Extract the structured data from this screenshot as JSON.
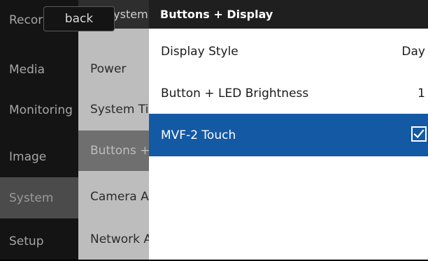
{
  "left_menu": {
    "items": [
      {
        "label": "Record"
      },
      {
        "label": "Media"
      },
      {
        "label": "Monitoring"
      },
      {
        "label": "Image"
      },
      {
        "label": "System",
        "selected": true
      },
      {
        "label": "Setup"
      }
    ]
  },
  "mid_menu": {
    "header": "System",
    "items": [
      {
        "label": "Power"
      },
      {
        "label": "System Time"
      },
      {
        "label": "Buttons + Display",
        "selected": true
      },
      {
        "label": "Camera Access"
      },
      {
        "label": "Network Access"
      }
    ]
  },
  "back_button": {
    "label": "back"
  },
  "settings_panel": {
    "title": "Buttons + Display",
    "rows": [
      {
        "label": "Display Style",
        "value": "Day"
      },
      {
        "label": "Button + LED Brightness",
        "value": "1"
      },
      {
        "label": "MVF-2 Touch",
        "checked": true,
        "selected": true
      }
    ]
  },
  "colors": {
    "selection_blue": "#1459a4",
    "panel_dark": "#141414",
    "panel_mid": "#bdbdbd"
  }
}
